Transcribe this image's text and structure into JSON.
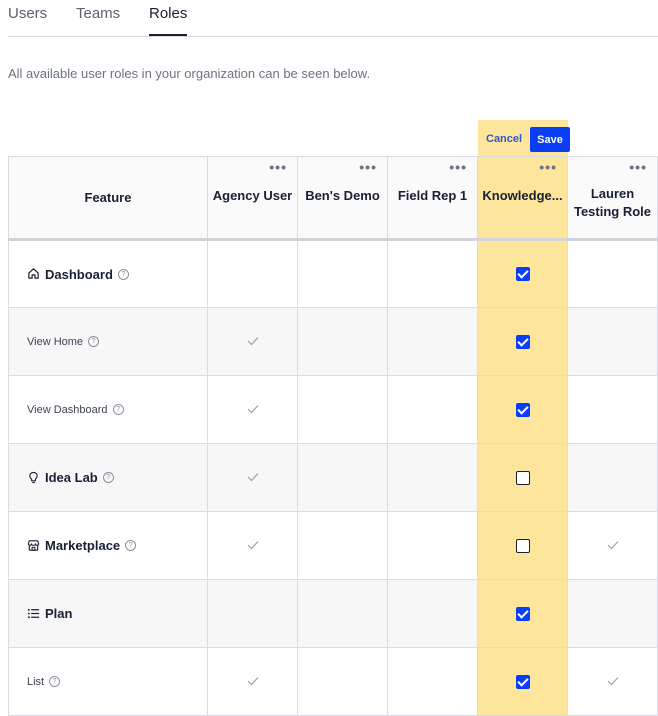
{
  "tabs": [
    {
      "label": "Users",
      "active": false
    },
    {
      "label": "Teams",
      "active": false
    },
    {
      "label": "Roles",
      "active": true
    }
  ],
  "subtitle": "All available user roles in your organization can be seen below.",
  "edit_bar": {
    "cancel_label": "Cancel",
    "save_label": "Save",
    "highlight_color": "#fde59b",
    "save_color": "#0b3df5"
  },
  "table": {
    "feature_header": "Feature",
    "role_menu_glyph": "•••",
    "roles": [
      {
        "name": "Agency User"
      },
      {
        "name": "Ben's Demo"
      },
      {
        "name": "Field Rep 1"
      },
      {
        "name": "Knowledge..."
      },
      {
        "name": "Lauren Testing Role"
      }
    ],
    "rows": [
      {
        "label": "Dashboard",
        "type": "section",
        "icon": "home-icon",
        "help": true,
        "cells": [
          "",
          "",
          "",
          "checked",
          ""
        ]
      },
      {
        "label": "View Home",
        "type": "sub",
        "help": true,
        "cells": [
          "tick",
          "",
          "",
          "checked",
          ""
        ]
      },
      {
        "label": "View Dashboard",
        "type": "sub",
        "help": true,
        "cells": [
          "tick",
          "",
          "",
          "checked",
          ""
        ]
      },
      {
        "label": "Idea Lab",
        "type": "section",
        "icon": "lightbulb-icon",
        "help": true,
        "cells": [
          "tick",
          "",
          "",
          "unchecked",
          ""
        ]
      },
      {
        "label": "Marketplace",
        "type": "section",
        "icon": "store-icon",
        "help": true,
        "cells": [
          "tick",
          "",
          "",
          "unchecked",
          "tick"
        ]
      },
      {
        "label": "Plan",
        "type": "section",
        "icon": "list-icon",
        "help": false,
        "cells": [
          "",
          "",
          "",
          "checked",
          ""
        ]
      },
      {
        "label": "List",
        "type": "sub",
        "help": true,
        "cells": [
          "tick",
          "",
          "",
          "checked",
          "tick"
        ]
      }
    ]
  }
}
